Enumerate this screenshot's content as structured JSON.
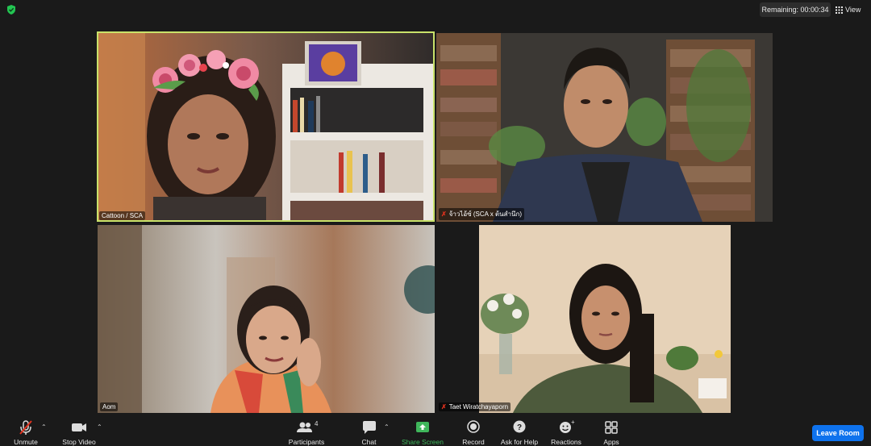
{
  "window": {
    "remaining": "Remaining: 00:00:34",
    "view_label": "View"
  },
  "participants": [
    {
      "name": "Cattoon / SCA",
      "muted": false,
      "active_speaker": true
    },
    {
      "name": "จ้าวไอ้ซ์ (SCA x ต้นสำนึก)",
      "muted": true,
      "active_speaker": false
    },
    {
      "name": "Aom",
      "muted": false,
      "active_speaker": false
    },
    {
      "name": "Taet Wiratchayaporn",
      "muted": true,
      "active_speaker": false
    }
  ],
  "toolbar": {
    "unmute": "Unmute",
    "stop_video": "Stop Video",
    "participants": "Participants",
    "participants_count": "4",
    "chat": "Chat",
    "share_screen": "Share Screen",
    "record": "Record",
    "ask_for_help": "Ask for Help",
    "reactions": "Reactions",
    "apps": "Apps",
    "leave_room": "Leave Room"
  },
  "colors": {
    "active_speaker_border": "#c9e26a",
    "share_green": "#3fb65b",
    "leave_blue": "#0e72ed",
    "muted_red": "#e0321e"
  }
}
